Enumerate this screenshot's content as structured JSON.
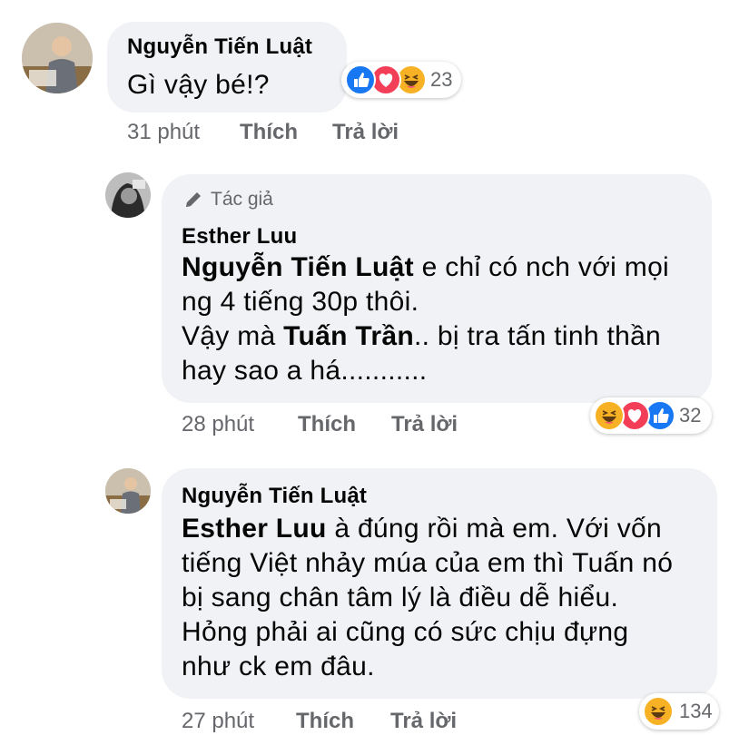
{
  "comments": [
    {
      "author": "Nguyễn Tiến Luật",
      "text": "Gì vậy bé!?",
      "time": "31 phút",
      "like_label": "Thích",
      "reply_label": "Trả lời",
      "reaction_count": "23",
      "reactions": [
        "like-icon",
        "love-icon",
        "haha-icon"
      ]
    },
    {
      "author_badge": "Tác giả",
      "author": "Esther Luu",
      "mention": "Nguyễn Tiến Luật",
      "text_1": " e chỉ có nch với mọi",
      "text_2": "ng 4 tiếng 30p thôi.",
      "text_3_pre": "Vậy mà ",
      "mention_2": "Tuấn Trần",
      "text_3_post": ".. bị tra tấn tinh thần",
      "text_4": "hay sao a há...........",
      "time": "28 phút",
      "like_label": "Thích",
      "reply_label": "Trả lời",
      "reaction_count": "32",
      "reactions": [
        "haha-icon",
        "love-icon",
        "like-icon"
      ]
    },
    {
      "author": "Nguyễn Tiến Luật",
      "mention": "Esther Luu",
      "text_1": " à đúng rồi mà em. Với vốn",
      "text_2": "tiếng Việt nhảy múa của em thì Tuấn nó",
      "text_3": "bị sang chân tâm lý là điều dễ hiểu.",
      "text_4": "Hỏng phải ai cũng có sức chịu đựng",
      "text_5": "như ck em đâu.",
      "time": "27 phút",
      "like_label": "Thích",
      "reply_label": "Trả lời",
      "reaction_count": "134",
      "reactions": [
        "haha-icon"
      ]
    }
  ],
  "colors": {
    "bubble": "#f0f2f5",
    "meta_text": "#65676b",
    "like_blue": "#1877f2",
    "love_red": "#f33e58",
    "haha_yellow": "#f7b125"
  }
}
